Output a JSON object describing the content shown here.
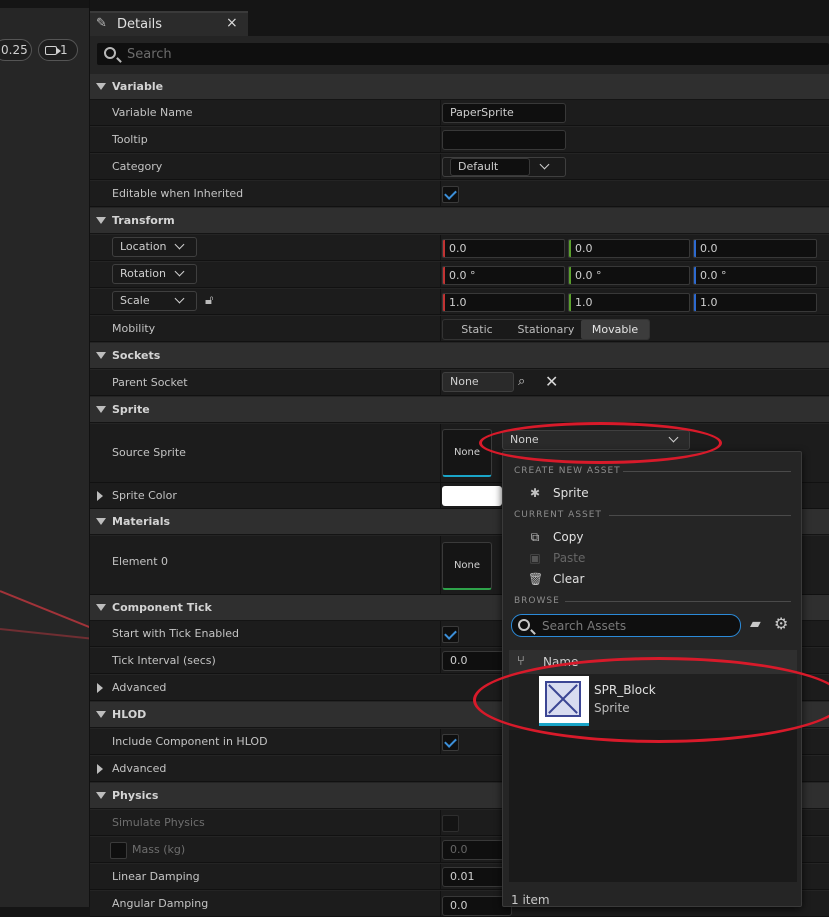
{
  "viewport": {
    "snap_value": "0.25",
    "camera_speed": "1"
  },
  "tab": {
    "title": "Details",
    "close": "×"
  },
  "search": {
    "placeholder": "Search"
  },
  "variable": {
    "header": "Variable",
    "name_label": "Variable Name",
    "name_value": "PaperSprite",
    "tooltip_label": "Tooltip",
    "tooltip_value": "",
    "category_label": "Category",
    "category_value": "Default",
    "editable_label": "Editable when Inherited",
    "editable_checked": true
  },
  "transform": {
    "header": "Transform",
    "location": {
      "label": "Location",
      "x": "0.0",
      "y": "0.0",
      "z": "0.0"
    },
    "rotation": {
      "label": "Rotation",
      "x": "0.0 °",
      "y": "0.0 °",
      "z": "0.0 °"
    },
    "scale": {
      "label": "Scale",
      "x": "1.0",
      "y": "1.0",
      "z": "1.0"
    },
    "mobility_label": "Mobility",
    "mobility_options": [
      "Static",
      "Stationary",
      "Movable"
    ],
    "mobility_selected": "Movable"
  },
  "sockets": {
    "header": "Sockets",
    "parent_label": "Parent Socket",
    "parent_value": "None"
  },
  "sprite": {
    "header": "Sprite",
    "source_label": "Source Sprite",
    "source_value": "None",
    "thumb_text": "None",
    "color_label": "Sprite Color"
  },
  "materials": {
    "header": "Materials",
    "element0_label": "Element 0",
    "element0_thumb": "None"
  },
  "component_tick": {
    "header": "Component Tick",
    "start_label": "Start with Tick Enabled",
    "start_checked": true,
    "interval_label": "Tick Interval (secs)",
    "interval_value": "0.0",
    "advanced_label": "Advanced"
  },
  "hlod": {
    "header": "HLOD",
    "include_label": "Include Component in HLOD",
    "include_checked": true,
    "advanced_label": "Advanced"
  },
  "physics": {
    "header": "Physics",
    "simulate_label": "Simulate Physics",
    "mass_label": "Mass (kg)",
    "mass_value": "0.0",
    "linear_label": "Linear Damping",
    "linear_value": "0.01",
    "angular_label": "Angular Damping",
    "angular_value": "0.0"
  },
  "menu": {
    "create_header": "CREATE NEW ASSET",
    "create_sprite": "Sprite",
    "current_header": "CURRENT ASSET",
    "copy": "Copy",
    "paste": "Paste",
    "clear": "Clear",
    "browse_header": "BROWSE",
    "search_placeholder": "Search Assets",
    "column_name": "Name",
    "asset": {
      "name": "SPR_Block",
      "type": "Sprite"
    },
    "item_count": "1 item"
  }
}
